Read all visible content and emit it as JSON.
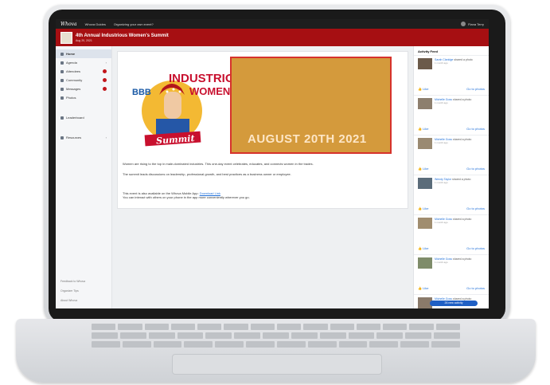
{
  "app": {
    "logo": "Whova",
    "nav_guides": "Whova Guides",
    "nav_organize": "Organizing your own event?",
    "user_name": "Fiana Terry"
  },
  "event": {
    "title": "4th Annual Industrious Women's Summit",
    "date": "Aug 20, 2021"
  },
  "sidebar": {
    "items": [
      {
        "label": "Home",
        "icon": "home-icon",
        "badge": "",
        "chevron": false,
        "active": true
      },
      {
        "label": "Agenda",
        "icon": "calendar-icon",
        "badge": "",
        "chevron": true,
        "active": false
      },
      {
        "label": "Attendees",
        "icon": "people-icon",
        "badge": "",
        "chevron": false,
        "active": false
      },
      {
        "label": "Community",
        "icon": "chat-icon",
        "badge": "",
        "chevron": false,
        "active": false
      },
      {
        "label": "Messages",
        "icon": "message-icon",
        "badge": "",
        "chevron": false,
        "active": false
      },
      {
        "label": "Photos",
        "icon": "photo-icon",
        "badge": "",
        "chevron": false,
        "active": false
      },
      {
        "label": "Leaderboard",
        "icon": "trophy-icon",
        "badge": "",
        "chevron": false,
        "active": false
      },
      {
        "label": "Resources",
        "icon": "folder-icon",
        "badge": "",
        "chevron": true,
        "active": false
      }
    ],
    "footer": [
      "Feedback to Whova",
      "Organizer Tips",
      "About Whova"
    ]
  },
  "hero": {
    "logo_line1": "INDUSTRIOUS",
    "logo_line2": "WOMEN'S",
    "logo_line3": "Summit",
    "bbb": "BBB",
    "date_text": "AUGUST 20TH 2021"
  },
  "description": {
    "p1": "Women are rising to the top in male-dominated industries. This one-day event celebrates, educates, and connects women in the trades.",
    "p2": "The summit leads discussions on leadership, professional growth, and best practices as a business owner or employee.",
    "p3a": "This event is also available on the Whova Mobile App:",
    "p3_link": "Download Link",
    "p3b": "You can interact with others on your phone in the app more conveniently wherever you go."
  },
  "activity": {
    "title": "Activity Feed",
    "items": [
      {
        "name": "Sarah Claridge",
        "action": "shared a photo",
        "time": "1 month ago",
        "like": "Like",
        "photos": "Go to photos"
      },
      {
        "name": "Michelle Goss",
        "action": "shared a photo",
        "time": "1 month ago",
        "like": "Like",
        "photos": "Go to photos"
      },
      {
        "name": "Michelle Goss",
        "action": "shared a photo",
        "time": "1 month ago",
        "like": "Like",
        "photos": "Go to photos"
      },
      {
        "name": "Wendy Taylor",
        "action": "shared a photo",
        "time": "1 month ago",
        "like": "Like",
        "photos": "Go to photos"
      },
      {
        "name": "Michelle Goss",
        "action": "shared a photo",
        "time": "1 month ago",
        "like": "Like",
        "photos": "Go to photos"
      },
      {
        "name": "Michelle Goss",
        "action": "shared a photo",
        "time": "1 month ago",
        "like": "Like",
        "photos": "Go to photos"
      },
      {
        "name": "Michelle Goss",
        "action": "shared a photo",
        "time": "1 month ago",
        "like": "",
        "photos": ""
      }
    ],
    "new_activity": "26 new activity"
  },
  "colors": {
    "brand_red": "#a60f12",
    "link_blue": "#1f6fd8",
    "button_blue": "#1f5fc4"
  }
}
